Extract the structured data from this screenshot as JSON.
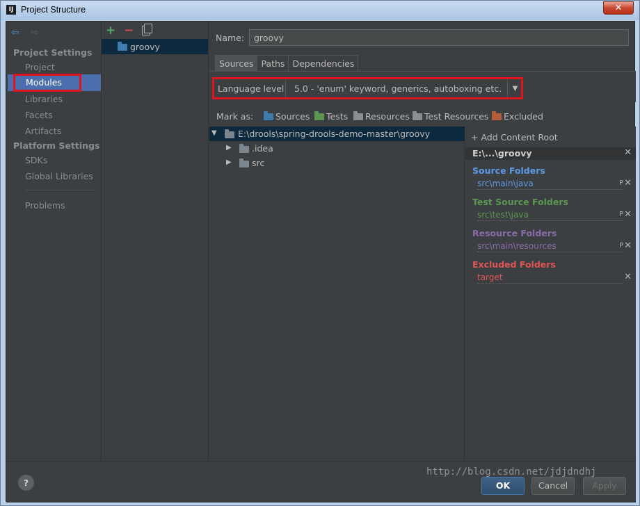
{
  "window": {
    "title": "Project Structure",
    "close": "✕"
  },
  "nav": {
    "heading_project": "Project Settings",
    "heading_platform": "Platform Settings",
    "items": [
      "Project",
      "Modules",
      "Libraries",
      "Facets",
      "Artifacts",
      "SDKs",
      "Global Libraries",
      "Problems"
    ],
    "selected": "Modules"
  },
  "modules": {
    "list": [
      "groovy"
    ]
  },
  "main": {
    "name_label": "Name:",
    "name_value": "groovy",
    "tabs": [
      "Sources",
      "Paths",
      "Dependencies"
    ],
    "active_tab": "Sources",
    "language_level_label": "Language level:",
    "language_level_value": "5.0 - 'enum' keyword, generics, autoboxing etc.",
    "mark_as_label": "Mark as:",
    "mark_as": [
      "Sources",
      "Tests",
      "Resources",
      "Test Resources",
      "Excluded"
    ],
    "tree": {
      "root": "E:\\drools\\spring-drools-demo-master\\groovy",
      "children": [
        ".idea",
        "src"
      ]
    }
  },
  "roots": {
    "add_label": "Add Content Root",
    "root_title": "E:\\...\\groovy",
    "sections": [
      {
        "title": "Source Folders",
        "entry": "src\\main\\java",
        "color": "#5c9ae6"
      },
      {
        "title": "Test Source Folders",
        "entry": "src\\test\\java",
        "color": "#5c9650"
      },
      {
        "title": "Resource Folders",
        "entry": "src\\main\\resources",
        "color": "#8a6ba8"
      },
      {
        "title": "Excluded Folders",
        "entry": "target",
        "color": "#e05555"
      }
    ]
  },
  "footer": {
    "help": "?",
    "ok": "OK",
    "cancel": "Cancel",
    "apply": "Apply"
  },
  "watermark": "http://blog.csdn.net/jdjdndhj"
}
